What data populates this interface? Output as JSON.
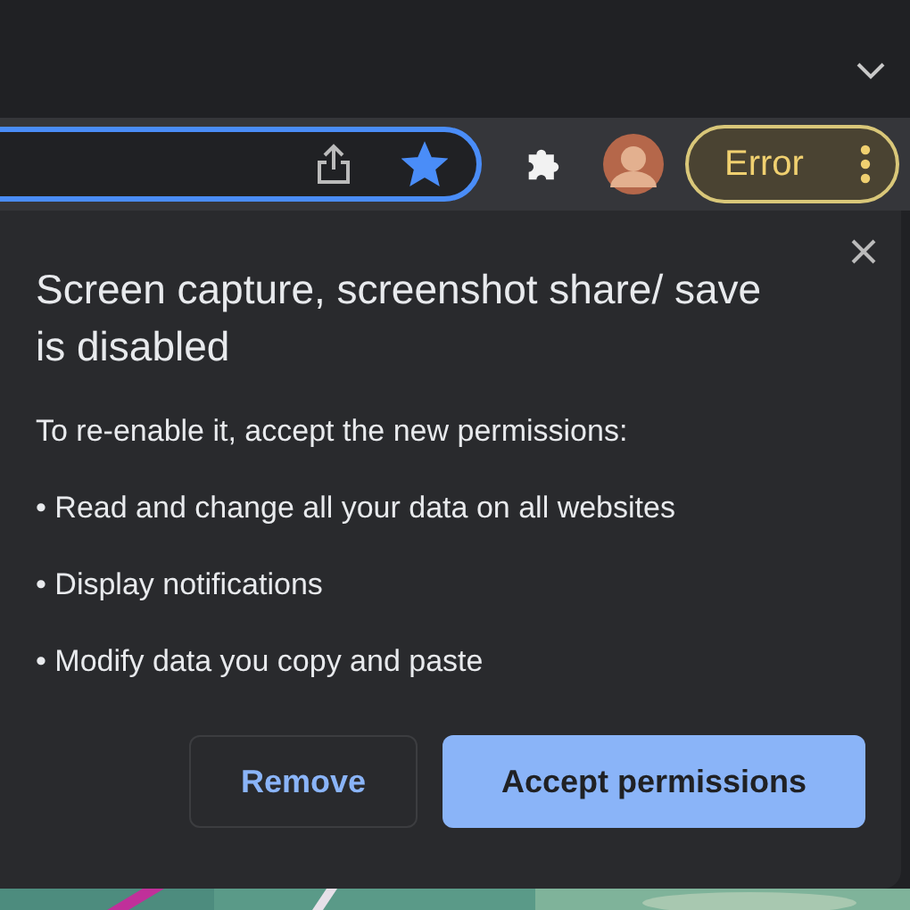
{
  "toolbar": {
    "error_chip": "Error",
    "bookmarked": true
  },
  "dialog": {
    "title": "Screen capture, screenshot share/ save is disabled",
    "intro": "To re-enable it, accept the new permissions:",
    "permissions": [
      "• Read and change all your data on all websites",
      "• Display notifications",
      "• Modify data you copy and paste"
    ],
    "buttons": [
      {
        "label": "Remove",
        "kind": "secondary"
      },
      {
        "label": "Accept permissions",
        "kind": "primary"
      }
    ]
  }
}
